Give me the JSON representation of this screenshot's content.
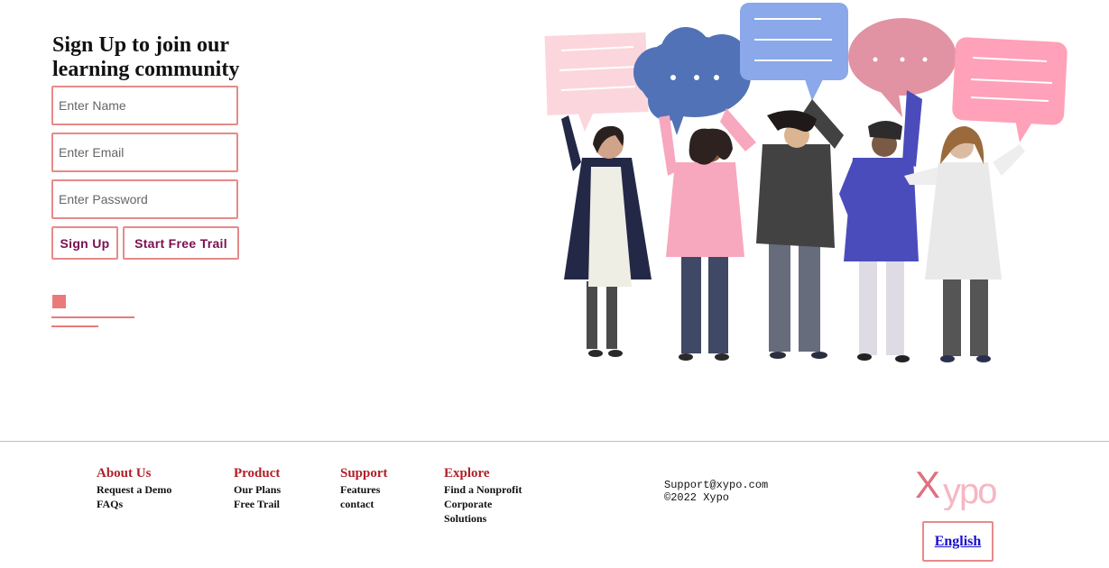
{
  "signup": {
    "title": "Sign Up to join our learning community",
    "name_placeholder": "Enter Name",
    "email_placeholder": "Enter Email",
    "password_placeholder": "Enter Password",
    "signup_label": "Sign Up",
    "trail_label": "Start Free Trail"
  },
  "illustration": {
    "icon": "people-with-speech-bubbles-illustration"
  },
  "footer": {
    "columns": [
      {
        "heading": "About Us",
        "links": [
          "Request a Demo",
          "FAQs"
        ]
      },
      {
        "heading": "Product",
        "links": [
          "Our Plans",
          "Free Trail"
        ]
      },
      {
        "heading": "Support",
        "links": [
          "Features",
          "contact"
        ]
      },
      {
        "heading": "Explore",
        "links": [
          "Find a Nonprofit",
          "Corporate",
          "Solutions"
        ]
      }
    ],
    "email": "Support@xypo.com",
    "copyright": "©2022 Xypo",
    "logo": {
      "x": "X",
      "rest": "ypo"
    },
    "language": "English"
  },
  "colors": {
    "accent": "#e78a8a",
    "button_text": "#7a0f4f",
    "footer_heading": "#b01f28",
    "logo_x": "#e0707f",
    "logo_rest": "#f5b7c3"
  }
}
